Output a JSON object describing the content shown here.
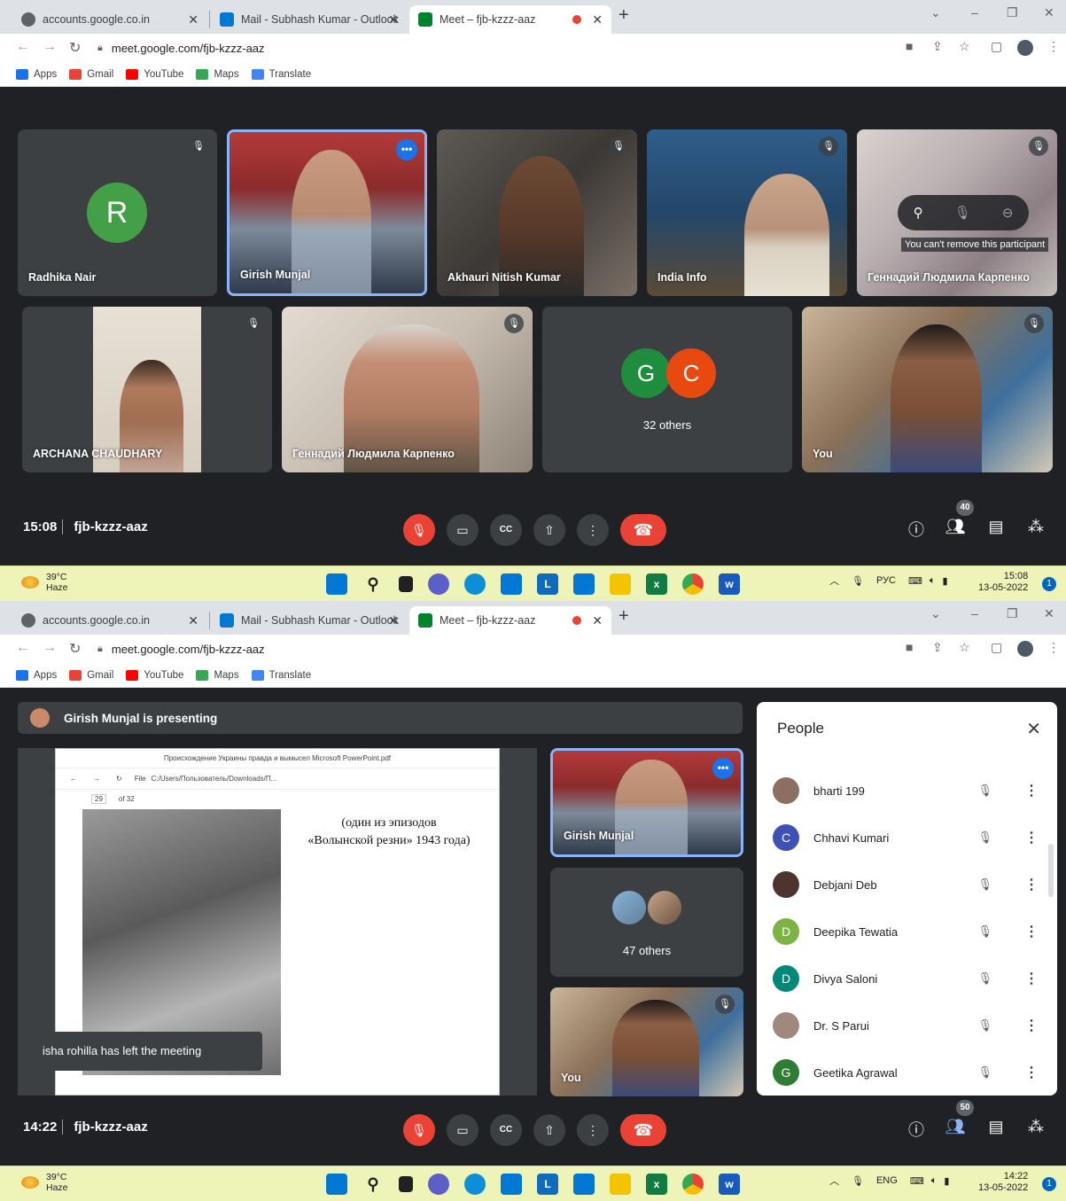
{
  "browser": {
    "tabs": [
      {
        "title": "accounts.google.co.in",
        "color": "#5f6368"
      },
      {
        "title": "Mail - Subhash Kumar - Outlook",
        "color": "#0078d4"
      },
      {
        "title": "Meet – fjb-kzzz-aaz",
        "color": "#00832d"
      }
    ],
    "new_tab": "+",
    "url": "meet.google.com/fjb-kzzz-aaz",
    "bookmarks": [
      {
        "label": "Apps",
        "color": "#1a73e8"
      },
      {
        "label": "Gmail",
        "color": "#ea4335"
      },
      {
        "label": "YouTube",
        "color": "#ff0000"
      },
      {
        "label": "Maps",
        "color": "#34a853"
      },
      {
        "label": "Translate",
        "color": "#4285f4"
      }
    ]
  },
  "frame1": {
    "participants": [
      {
        "name": "Radhika Nair",
        "initial": "R",
        "avatar_color": "#43a047"
      },
      {
        "name": "Girish Munjal",
        "more": "•••"
      },
      {
        "name": "Akhauri Nitish Kumar"
      },
      {
        "name": "India Info"
      },
      {
        "name": "Геннадий Людмила Карпенко",
        "tooltip": "You can't remove this participant"
      },
      {
        "name": "ARCHANA CHAUDHARY"
      },
      {
        "name": "Геннадий Людмила Карпенко"
      },
      {
        "name": "",
        "others": "32 others",
        "avatars": [
          {
            "initial": "G",
            "color": "#1e8e3e"
          },
          {
            "initial": "C",
            "color": "#e8490f"
          }
        ]
      },
      {
        "name": "You"
      }
    ],
    "time": "15:08",
    "code": "fjb-kzzz-aaz",
    "people_count": "40",
    "taskbar": {
      "temp": "39°C",
      "weather": "Haze",
      "lang": "РУС",
      "time": "15:08",
      "date": "13-05-2022",
      "notif": "1"
    }
  },
  "frame2": {
    "presenting": "Girish Munjal is presenting",
    "pdf": {
      "title": "Происхождение Украины правда и вымысел Microsoft PowerPoint.pdf",
      "path": "C:/Users/Пользователь/Downloads/П...",
      "file": "File",
      "page": "29",
      "of": "of 32",
      "text_line1": "(один из эпизодов",
      "text_line2": "«Волынской резни» 1943 года)"
    },
    "toast": "isha rohilla has left the meeting",
    "side": [
      {
        "name": "Girish Munjal",
        "more": "•••"
      },
      {
        "others": "47 others"
      },
      {
        "name": "You"
      }
    ],
    "people_panel": {
      "title": "People",
      "rows": [
        {
          "name": "bharti 199",
          "initial": "",
          "color": "#8d6e63"
        },
        {
          "name": "Chhavi Kumari",
          "initial": "C",
          "color": "#3f51b5"
        },
        {
          "name": "Debjani Deb",
          "initial": "",
          "color": "#4e342e"
        },
        {
          "name": "Deepika Tewatia",
          "initial": "D",
          "color": "#7cb342"
        },
        {
          "name": "Divya Saloni",
          "initial": "D",
          "color": "#00897b"
        },
        {
          "name": "Dr. S Parui",
          "initial": "",
          "color": "#a1887f"
        },
        {
          "name": "Geetika Agrawal",
          "initial": "G",
          "color": "#2e7d32"
        }
      ]
    },
    "time": "14:22",
    "code": "fjb-kzzz-aaz",
    "people_count": "50",
    "taskbar": {
      "temp": "39°C",
      "weather": "Haze",
      "lang": "ENG",
      "time": "14:22",
      "date": "13-05-2022",
      "notif": "1"
    }
  }
}
